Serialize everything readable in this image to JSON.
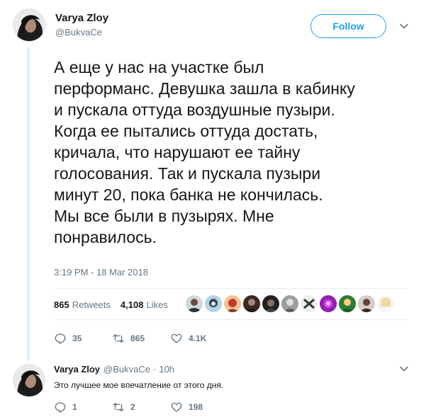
{
  "tweet": {
    "author_name": "Varya Zloy",
    "author_handle": "@BukvaCe",
    "follow_label": "Follow",
    "text_lines": [
      "А еще у нас на участке был",
      "перформанс. Девушка зашла в кабинку",
      "и пускала оттуда воздушные пузыри.",
      "Когда ее пытались оттуда достать,",
      "кричала, что нарушают ее тайну",
      "голосования. Так и пускала пузыри",
      "минут 20, пока банка не кончилась.",
      "Мы все были в пузырях. Мне",
      "понравилось."
    ],
    "timestamp": "3:19 PM - 18 Mar 2018",
    "retweets_count": "865",
    "retweets_label": "Retweets",
    "likes_count": "4,108",
    "likes_label": "Likes",
    "actions": {
      "reply_count": "35",
      "retweet_count": "865",
      "like_count": "4.1K"
    }
  },
  "reply": {
    "author_name": "Varya Zloy",
    "author_handle": "@BukvaCe",
    "separator": "·",
    "time": "10h",
    "text": "Это лучшее мое впечатление от этого дня.",
    "actions": {
      "reply_count": "1",
      "retweet_count": "2",
      "like_count": "198"
    }
  },
  "colors": {
    "accent": "#1da1f2",
    "muted": "#657786",
    "text": "#14171a",
    "thread_line": "#cfe6f5"
  },
  "icons": [
    "chevron-down-icon",
    "reply-icon",
    "retweet-icon",
    "heart-icon"
  ]
}
